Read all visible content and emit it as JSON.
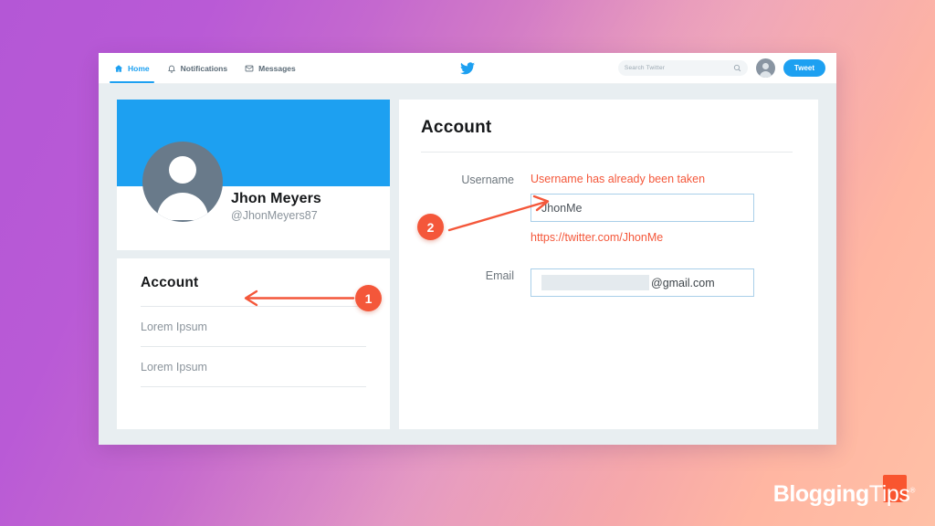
{
  "browser": {
    "nav": {
      "tabs": [
        {
          "label": "Home",
          "icon": "home-icon",
          "active": true
        },
        {
          "label": "Notifications",
          "icon": "bell-icon",
          "active": false
        },
        {
          "label": "Messages",
          "icon": "envelope-icon",
          "active": false
        }
      ],
      "brand_icon": "twitter-bird-icon",
      "search": {
        "placeholder": "Search Twitter",
        "value": "",
        "icon": "search-icon"
      },
      "avatar_icon": "user-avatar-icon",
      "tweet_button": "Tweet"
    }
  },
  "profile": {
    "name": "Jhon Meyers",
    "handle": "@JhonMeyers87",
    "avatar_icon": "user-avatar-icon"
  },
  "sidebar": {
    "title": "Account",
    "items": [
      {
        "label": "Lorem Ipsum"
      },
      {
        "label": "Lorem Ipsum"
      }
    ]
  },
  "main": {
    "title": "Account",
    "username": {
      "label": "Username",
      "error": "Username has already been taken",
      "value": "JhonMe",
      "helper_url": "https://twitter.com/JhonMe"
    },
    "email": {
      "label": "Email",
      "value_redacted": true,
      "suffix": "@gmail.com"
    }
  },
  "annotations": [
    {
      "number": "1",
      "target": "sidebar-account-title"
    },
    {
      "number": "2",
      "target": "username-input"
    }
  ],
  "logo": {
    "bold_part": "Blogging",
    "thin_part": "Tips",
    "trademark": "®"
  },
  "colors": {
    "accent_blue": "#1da0f1",
    "annotation_orange": "#f4573a",
    "gradient_start": "#b457d6",
    "gradient_end": "#ffc0a6",
    "app_background": "#e8eef1"
  }
}
